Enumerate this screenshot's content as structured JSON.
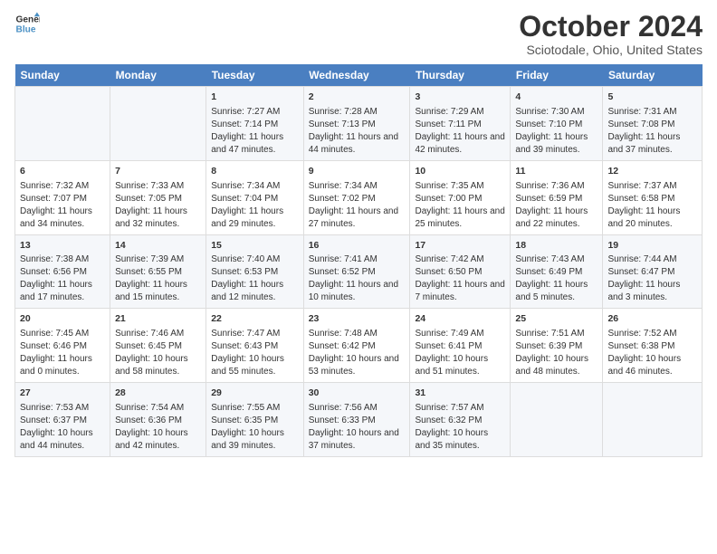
{
  "header": {
    "logo_line1": "General",
    "logo_line2": "Blue",
    "title": "October 2024",
    "subtitle": "Sciotodale, Ohio, United States"
  },
  "days_of_week": [
    "Sunday",
    "Monday",
    "Tuesday",
    "Wednesday",
    "Thursday",
    "Friday",
    "Saturday"
  ],
  "weeks": [
    [
      {
        "day": "",
        "content": ""
      },
      {
        "day": "",
        "content": ""
      },
      {
        "day": "1",
        "content": "Sunrise: 7:27 AM\nSunset: 7:14 PM\nDaylight: 11 hours and 47 minutes."
      },
      {
        "day": "2",
        "content": "Sunrise: 7:28 AM\nSunset: 7:13 PM\nDaylight: 11 hours and 44 minutes."
      },
      {
        "day": "3",
        "content": "Sunrise: 7:29 AM\nSunset: 7:11 PM\nDaylight: 11 hours and 42 minutes."
      },
      {
        "day": "4",
        "content": "Sunrise: 7:30 AM\nSunset: 7:10 PM\nDaylight: 11 hours and 39 minutes."
      },
      {
        "day": "5",
        "content": "Sunrise: 7:31 AM\nSunset: 7:08 PM\nDaylight: 11 hours and 37 minutes."
      }
    ],
    [
      {
        "day": "6",
        "content": "Sunrise: 7:32 AM\nSunset: 7:07 PM\nDaylight: 11 hours and 34 minutes."
      },
      {
        "day": "7",
        "content": "Sunrise: 7:33 AM\nSunset: 7:05 PM\nDaylight: 11 hours and 32 minutes."
      },
      {
        "day": "8",
        "content": "Sunrise: 7:34 AM\nSunset: 7:04 PM\nDaylight: 11 hours and 29 minutes."
      },
      {
        "day": "9",
        "content": "Sunrise: 7:34 AM\nSunset: 7:02 PM\nDaylight: 11 hours and 27 minutes."
      },
      {
        "day": "10",
        "content": "Sunrise: 7:35 AM\nSunset: 7:00 PM\nDaylight: 11 hours and 25 minutes."
      },
      {
        "day": "11",
        "content": "Sunrise: 7:36 AM\nSunset: 6:59 PM\nDaylight: 11 hours and 22 minutes."
      },
      {
        "day": "12",
        "content": "Sunrise: 7:37 AM\nSunset: 6:58 PM\nDaylight: 11 hours and 20 minutes."
      }
    ],
    [
      {
        "day": "13",
        "content": "Sunrise: 7:38 AM\nSunset: 6:56 PM\nDaylight: 11 hours and 17 minutes."
      },
      {
        "day": "14",
        "content": "Sunrise: 7:39 AM\nSunset: 6:55 PM\nDaylight: 11 hours and 15 minutes."
      },
      {
        "day": "15",
        "content": "Sunrise: 7:40 AM\nSunset: 6:53 PM\nDaylight: 11 hours and 12 minutes."
      },
      {
        "day": "16",
        "content": "Sunrise: 7:41 AM\nSunset: 6:52 PM\nDaylight: 11 hours and 10 minutes."
      },
      {
        "day": "17",
        "content": "Sunrise: 7:42 AM\nSunset: 6:50 PM\nDaylight: 11 hours and 7 minutes."
      },
      {
        "day": "18",
        "content": "Sunrise: 7:43 AM\nSunset: 6:49 PM\nDaylight: 11 hours and 5 minutes."
      },
      {
        "day": "19",
        "content": "Sunrise: 7:44 AM\nSunset: 6:47 PM\nDaylight: 11 hours and 3 minutes."
      }
    ],
    [
      {
        "day": "20",
        "content": "Sunrise: 7:45 AM\nSunset: 6:46 PM\nDaylight: 11 hours and 0 minutes."
      },
      {
        "day": "21",
        "content": "Sunrise: 7:46 AM\nSunset: 6:45 PM\nDaylight: 10 hours and 58 minutes."
      },
      {
        "day": "22",
        "content": "Sunrise: 7:47 AM\nSunset: 6:43 PM\nDaylight: 10 hours and 55 minutes."
      },
      {
        "day": "23",
        "content": "Sunrise: 7:48 AM\nSunset: 6:42 PM\nDaylight: 10 hours and 53 minutes."
      },
      {
        "day": "24",
        "content": "Sunrise: 7:49 AM\nSunset: 6:41 PM\nDaylight: 10 hours and 51 minutes."
      },
      {
        "day": "25",
        "content": "Sunrise: 7:51 AM\nSunset: 6:39 PM\nDaylight: 10 hours and 48 minutes."
      },
      {
        "day": "26",
        "content": "Sunrise: 7:52 AM\nSunset: 6:38 PM\nDaylight: 10 hours and 46 minutes."
      }
    ],
    [
      {
        "day": "27",
        "content": "Sunrise: 7:53 AM\nSunset: 6:37 PM\nDaylight: 10 hours and 44 minutes."
      },
      {
        "day": "28",
        "content": "Sunrise: 7:54 AM\nSunset: 6:36 PM\nDaylight: 10 hours and 42 minutes."
      },
      {
        "day": "29",
        "content": "Sunrise: 7:55 AM\nSunset: 6:35 PM\nDaylight: 10 hours and 39 minutes."
      },
      {
        "day": "30",
        "content": "Sunrise: 7:56 AM\nSunset: 6:33 PM\nDaylight: 10 hours and 37 minutes."
      },
      {
        "day": "31",
        "content": "Sunrise: 7:57 AM\nSunset: 6:32 PM\nDaylight: 10 hours and 35 minutes."
      },
      {
        "day": "",
        "content": ""
      },
      {
        "day": "",
        "content": ""
      }
    ]
  ]
}
